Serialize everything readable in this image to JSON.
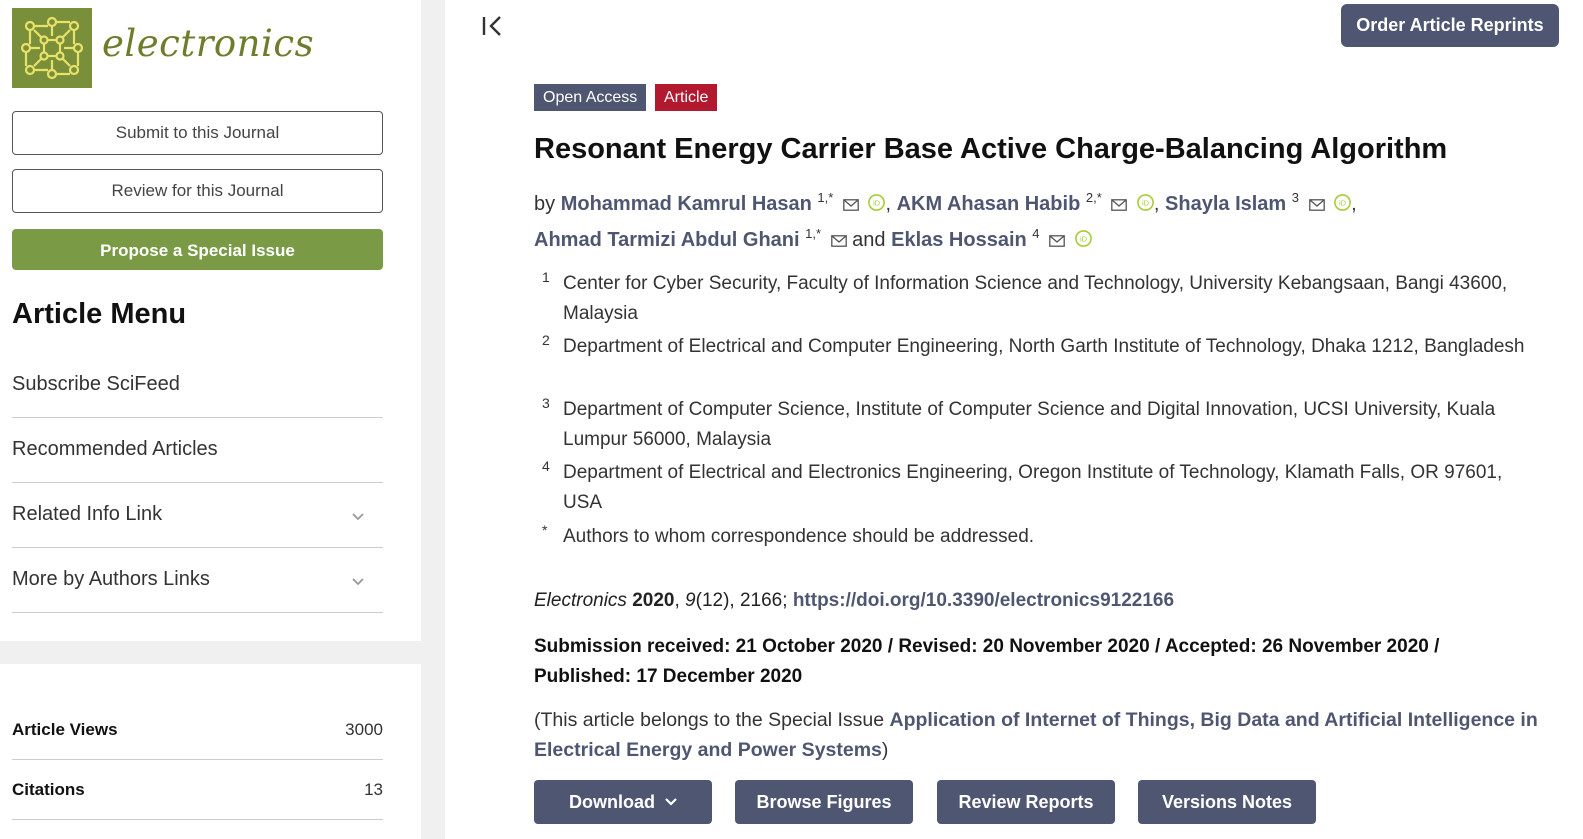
{
  "sidebar": {
    "logo_text": "electronics",
    "submit_label": "Submit to this Journal",
    "review_label": "Review for this Journal",
    "propose_label": "Propose a Special Issue",
    "menu_title": "Article Menu",
    "menu_items": [
      {
        "label": "Subscribe SciFeed",
        "expandable": false
      },
      {
        "label": "Recommended Articles",
        "expandable": false
      },
      {
        "label": "Related Info Link",
        "expandable": true
      },
      {
        "label": "More by Authors Links",
        "expandable": true
      }
    ],
    "stats": [
      {
        "label": "Article Views",
        "value": "3000"
      },
      {
        "label": "Citations",
        "value": "13"
      }
    ]
  },
  "main": {
    "reprints_label": "Order Article Reprints",
    "badge_open_access": "Open Access",
    "badge_article": "Article",
    "title": "Resonant Energy Carrier Base Active Charge-Balancing Algorithm",
    "by": "by",
    "and": "and",
    "authors": [
      {
        "name": "Mohammad Kamrul Hasan",
        "sup": "1,*"
      },
      {
        "name": "AKM Ahasan Habib",
        "sup": "2,*"
      },
      {
        "name": "Shayla Islam",
        "sup": "3"
      },
      {
        "name": "Ahmad Tarmizi Abdul Ghani",
        "sup": "1,*"
      },
      {
        "name": "Eklas Hossain",
        "sup": "4"
      }
    ],
    "affiliations": [
      {
        "num": "1",
        "text": "Center for Cyber Security, Faculty of Information Science and Technology, University Kebangsaan, Bangi 43600, Malaysia"
      },
      {
        "num": "2",
        "text": "Department of Electrical and Computer Engineering, North Garth Institute of Technology, Dhaka 1212, Bangladesh"
      },
      {
        "num": "3",
        "text": "Department of Computer Science, Institute of Computer Science and Digital Innovation, UCSI University, Kuala Lumpur 56000, Malaysia"
      },
      {
        "num": "4",
        "text": "Department of Electrical and Electronics Engineering, Oregon Institute of Technology, Klamath Falls, OR 97601, USA"
      },
      {
        "num": "*",
        "text": "Authors to whom correspondence should be addressed."
      }
    ],
    "citation": {
      "journal": "Electronics",
      "year": "2020",
      "volume": "9",
      "issue_pages": "(12), 2166;",
      "doi": "https://doi.org/10.3390/electronics9122166"
    },
    "dates": "Submission received: 21 October 2020 / Revised: 20 November 2020 / Accepted: 26 November 2020 / Published: 17 December 2020",
    "special_prefix": "(This article belongs to the Special Issue",
    "special_link": "Application of Internet of Things, Big Data and Artificial Intelligence in Electrical Energy and Power Systems",
    "special_suffix": ")",
    "buttons": {
      "download": "Download",
      "browse_figures": "Browse Figures",
      "review_reports": "Review Reports",
      "versions_notes": "Versions Notes"
    }
  },
  "colors": {
    "accent": "#4f5671",
    "article_badge": "#b2192f",
    "journal_green": "#7a8f3a",
    "propose_green": "#7a9a45",
    "orcid_green": "#a6ce39"
  }
}
